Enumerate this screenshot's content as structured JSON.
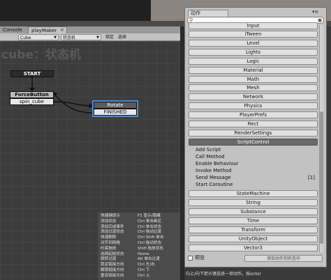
{
  "tabs": {
    "console": "Console",
    "playmaker": "playMaker",
    "close": "×"
  },
  "toolbar": {
    "object": "Cube",
    "fsm": "状态机",
    "lock": "锁定",
    "select": "选择"
  },
  "graph": {
    "title": "cube：状态机",
    "start_label": "START",
    "forcebutton": {
      "title": "ForceButton",
      "event": "spin_cube"
    },
    "rotate": {
      "title": "Rotate",
      "event": "FINISHED"
    }
  },
  "shortcuts": [
    {
      "key": "快捷键提示",
      "value": "F1 显示/隐藏"
    },
    {
      "key": "添加状态",
      "value": "Ctrl 单击画区"
    },
    {
      "key": "添加完成事件",
      "value": "Ctrl 单击状态"
    },
    {
      "key": "添加过渡状态",
      "value": "Ctrl 拖动过渡"
    },
    {
      "key": "快速删除",
      "value": "Ctrl Shift 单击"
    },
    {
      "key": "对齐到网格",
      "value": "Ctrl 拖动状态"
    },
    {
      "key": "约束拖放",
      "value": "Shift 拖放状态"
    },
    {
      "key": "选择起始状态",
      "value": "Home"
    },
    {
      "key": "跳转过渡",
      "value": "Alt 单击过渡"
    },
    {
      "key": "锁定链接方向",
      "value": "Ctrl 左/右"
    },
    {
      "key": "解锁链接方向",
      "value": "Ctrl 下"
    },
    {
      "key": "重设链接方向",
      "value": "Ctrl 上"
    }
  ],
  "panel": {
    "tab": "动作",
    "search_text": "",
    "search_icon": "search-icon",
    "categories_top": [
      "Input",
      "iTween",
      "Level",
      "Lights",
      "Logic",
      "Material",
      "Math",
      "Mesh",
      "Network",
      "Physics",
      "PlayerPrefs",
      "Rect",
      "RenderSettings"
    ],
    "selected_category": "ScriptControl",
    "actions": [
      {
        "name": "Add Script",
        "count": ""
      },
      {
        "name": "Call Method",
        "count": ""
      },
      {
        "name": "Enable Behaviour",
        "count": ""
      },
      {
        "name": "Invoke Method",
        "count": ""
      },
      {
        "name": "Send Message",
        "count": "[1]"
      },
      {
        "name": "Start Coroutine",
        "count": ""
      }
    ],
    "categories_bottom": [
      "StateMachine",
      "String",
      "Substance",
      "Time",
      "Transform",
      "UnityObject",
      "Vector3"
    ],
    "preview_label": "预览",
    "add_button": "添加动作到状态中"
  },
  "watermark": "http://blog.csdn.net/",
  "bottom_hint": "向上/向下箭头键选择一项动作。按enter"
}
